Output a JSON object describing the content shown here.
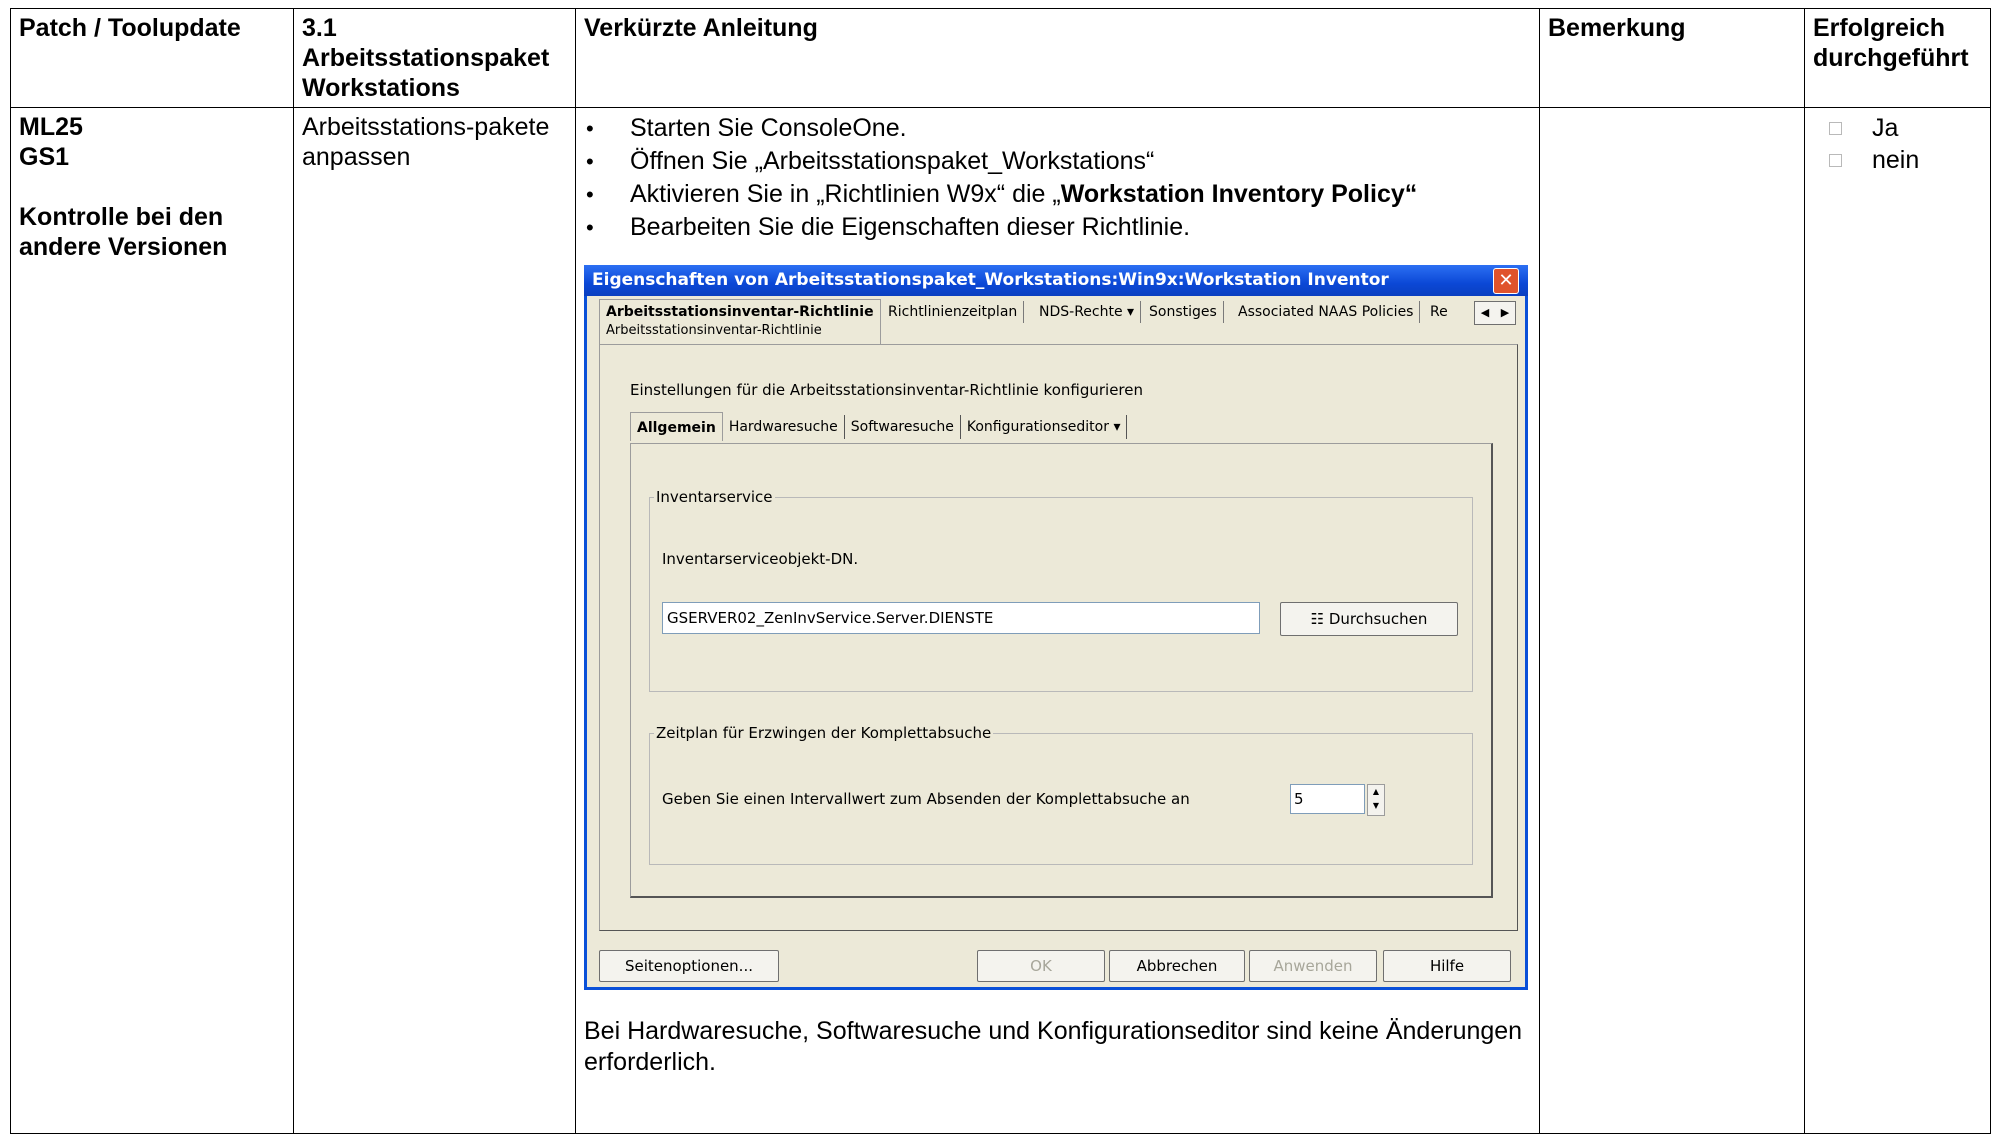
{
  "table": {
    "headers": {
      "col1": "Patch / Toolupdate",
      "col2_line1": "3.1",
      "col2_line2": "Arbeitsstationspaket",
      "col2_line3": "Workstations",
      "col3": "Verkürzte Anleitung",
      "col4": "Bemerkung",
      "col5_line1": "Erfolgreich",
      "col5_line2": "durchgeführt"
    },
    "row": {
      "patch_line1": "ML25",
      "patch_line2": "GS1",
      "patch_line3": "Kontrolle bei den",
      "patch_line4": "andere Versionen",
      "section_line1": "Arbeitsstations-pakete",
      "section_line2": "anpassen",
      "steps": {
        "s1": "Starten Sie ConsoleOne.",
        "s2": "Öffnen Sie „Arbeitsstationspaket_Workstations“",
        "s3_pre": "Aktivieren Sie in „Richtlinien W9x“ die „",
        "s3_bold": "Workstation Inventory Policy“",
        "s4": "Bearbeiten Sie die Eigenschaften dieser Richtlinie."
      },
      "note": "Bei Hardwaresuche, Softwaresuche und Konfigurationseditor sind keine Änderungen erforderlich.",
      "remark": "",
      "options": {
        "yes": "Ja",
        "no": "nein"
      }
    }
  },
  "dialog": {
    "title": "Eigenschaften von Arbeitsstationspaket_Workstations:Win9x:Workstation Inventor",
    "close_icon": "close-icon",
    "tabs": {
      "active_line1": "Arbeitsstationsinventar-Richtlinie",
      "active_line2": "Arbeitsstationsinventar-Richtlinie",
      "t2": "Richtlinienzeitplan",
      "t3": "NDS-Rechte ▾",
      "t4": "Sonstiges",
      "t5": "Associated NAAS Policies",
      "t6": "Re"
    },
    "heading": "Einstellungen für die Arbeitsstationsinventar-Richtlinie konfigurieren",
    "subtabs": {
      "s1": "Allgemein",
      "s2": "Hardwaresuche",
      "s3": "Softwaresuche",
      "s4": "Konfigurationseditor ▾"
    },
    "inventory_group": {
      "legend": "Inventarservice",
      "label": "Inventarserviceobjekt-DN.",
      "value": "GSERVER02_ZenInvService.Server.DIENSTE",
      "browse": "Durchsuchen"
    },
    "schedule_group": {
      "legend": "Zeitplan für Erzwingen der Komplettabsuche",
      "label": "Geben Sie einen Intervallwert zum Absenden der Komplettabsuche an",
      "value": "5"
    },
    "buttons": {
      "page_options": "Seitenoptionen...",
      "ok": "OK",
      "cancel": "Abbrechen",
      "apply": "Anwenden",
      "help": "Hilfe"
    }
  }
}
